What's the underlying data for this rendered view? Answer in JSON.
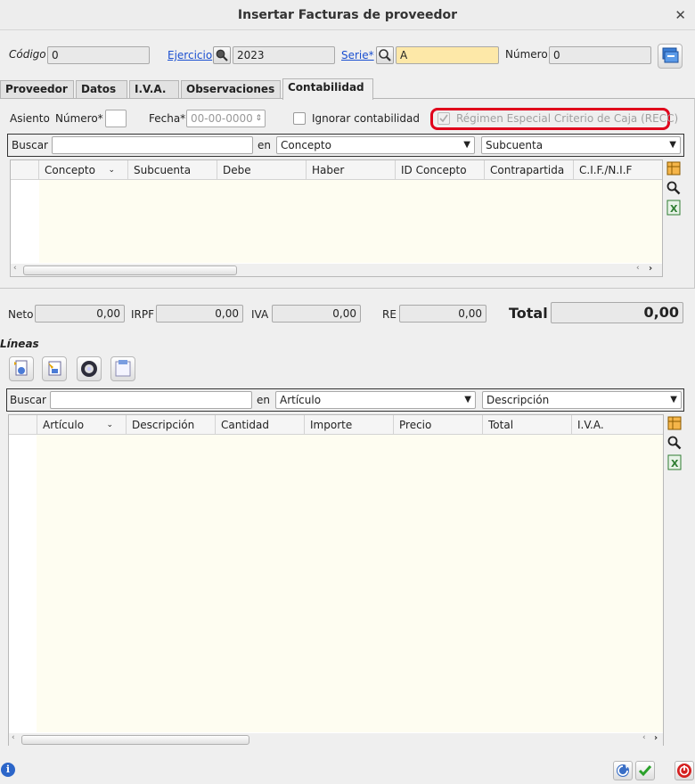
{
  "window": {
    "title": "Insertar Facturas de proveedor"
  },
  "header": {
    "codigo_label": "Código",
    "codigo_value": "0",
    "ejercicio_label": "Ejercicio",
    "ejercicio_value": "2023",
    "serie_label": "Serie*",
    "serie_value": "A",
    "numero_label": "Número",
    "numero_value": "0"
  },
  "tabs": [
    {
      "label": "Proveedor"
    },
    {
      "label": "Datos"
    },
    {
      "label": "I.V.A."
    },
    {
      "label": "Observaciones"
    },
    {
      "label": "Contabilidad",
      "active": true
    }
  ],
  "contabilidad": {
    "asiento_label": "Asiento",
    "numero_label": "Número*",
    "numero_value": "",
    "fecha_label": "Fecha*",
    "fecha_value": "00-00-0000",
    "ignorar_label": "Ignorar contabilidad",
    "ignorar_checked": false,
    "recc_label": "Régimen Especial Criterio de Caja (RECC)",
    "recc_checked": true,
    "recc_highlight_color": "#e0001b",
    "search": {
      "label": "Buscar",
      "value": "",
      "in_label": "en",
      "field": "Concepto",
      "column": "Subcuenta"
    },
    "columns": [
      "Concepto",
      "Subcuenta",
      "Debe",
      "Haber",
      "ID Concepto",
      "Contrapartida",
      "C.I.F./N.I.F"
    ]
  },
  "totals": {
    "neto_label": "Neto",
    "neto_value": "0,00",
    "irpf_label": "IRPF",
    "irpf_value": "0,00",
    "iva_label": "IVA",
    "iva_value": "0,00",
    "re_label": "RE",
    "re_value": "0,00",
    "total_label": "Total",
    "total_value": "0,00"
  },
  "lineas": {
    "title": "Líneas",
    "toolbar": [
      "add-line-icon",
      "edit-line-icon",
      "delete-line-icon",
      "open-line-icon"
    ],
    "search": {
      "label": "Buscar",
      "value": "",
      "in_label": "en",
      "field": "Artículo",
      "column": "Descripción"
    },
    "columns": [
      "Artículo",
      "Descripción",
      "Cantidad",
      "Importe",
      "Precio",
      "Total",
      "I.V.A."
    ]
  },
  "colors": {
    "accent_link": "#1a4fd0",
    "serie_bg": "#fde8a8",
    "grid_body": "#fefdf1"
  }
}
